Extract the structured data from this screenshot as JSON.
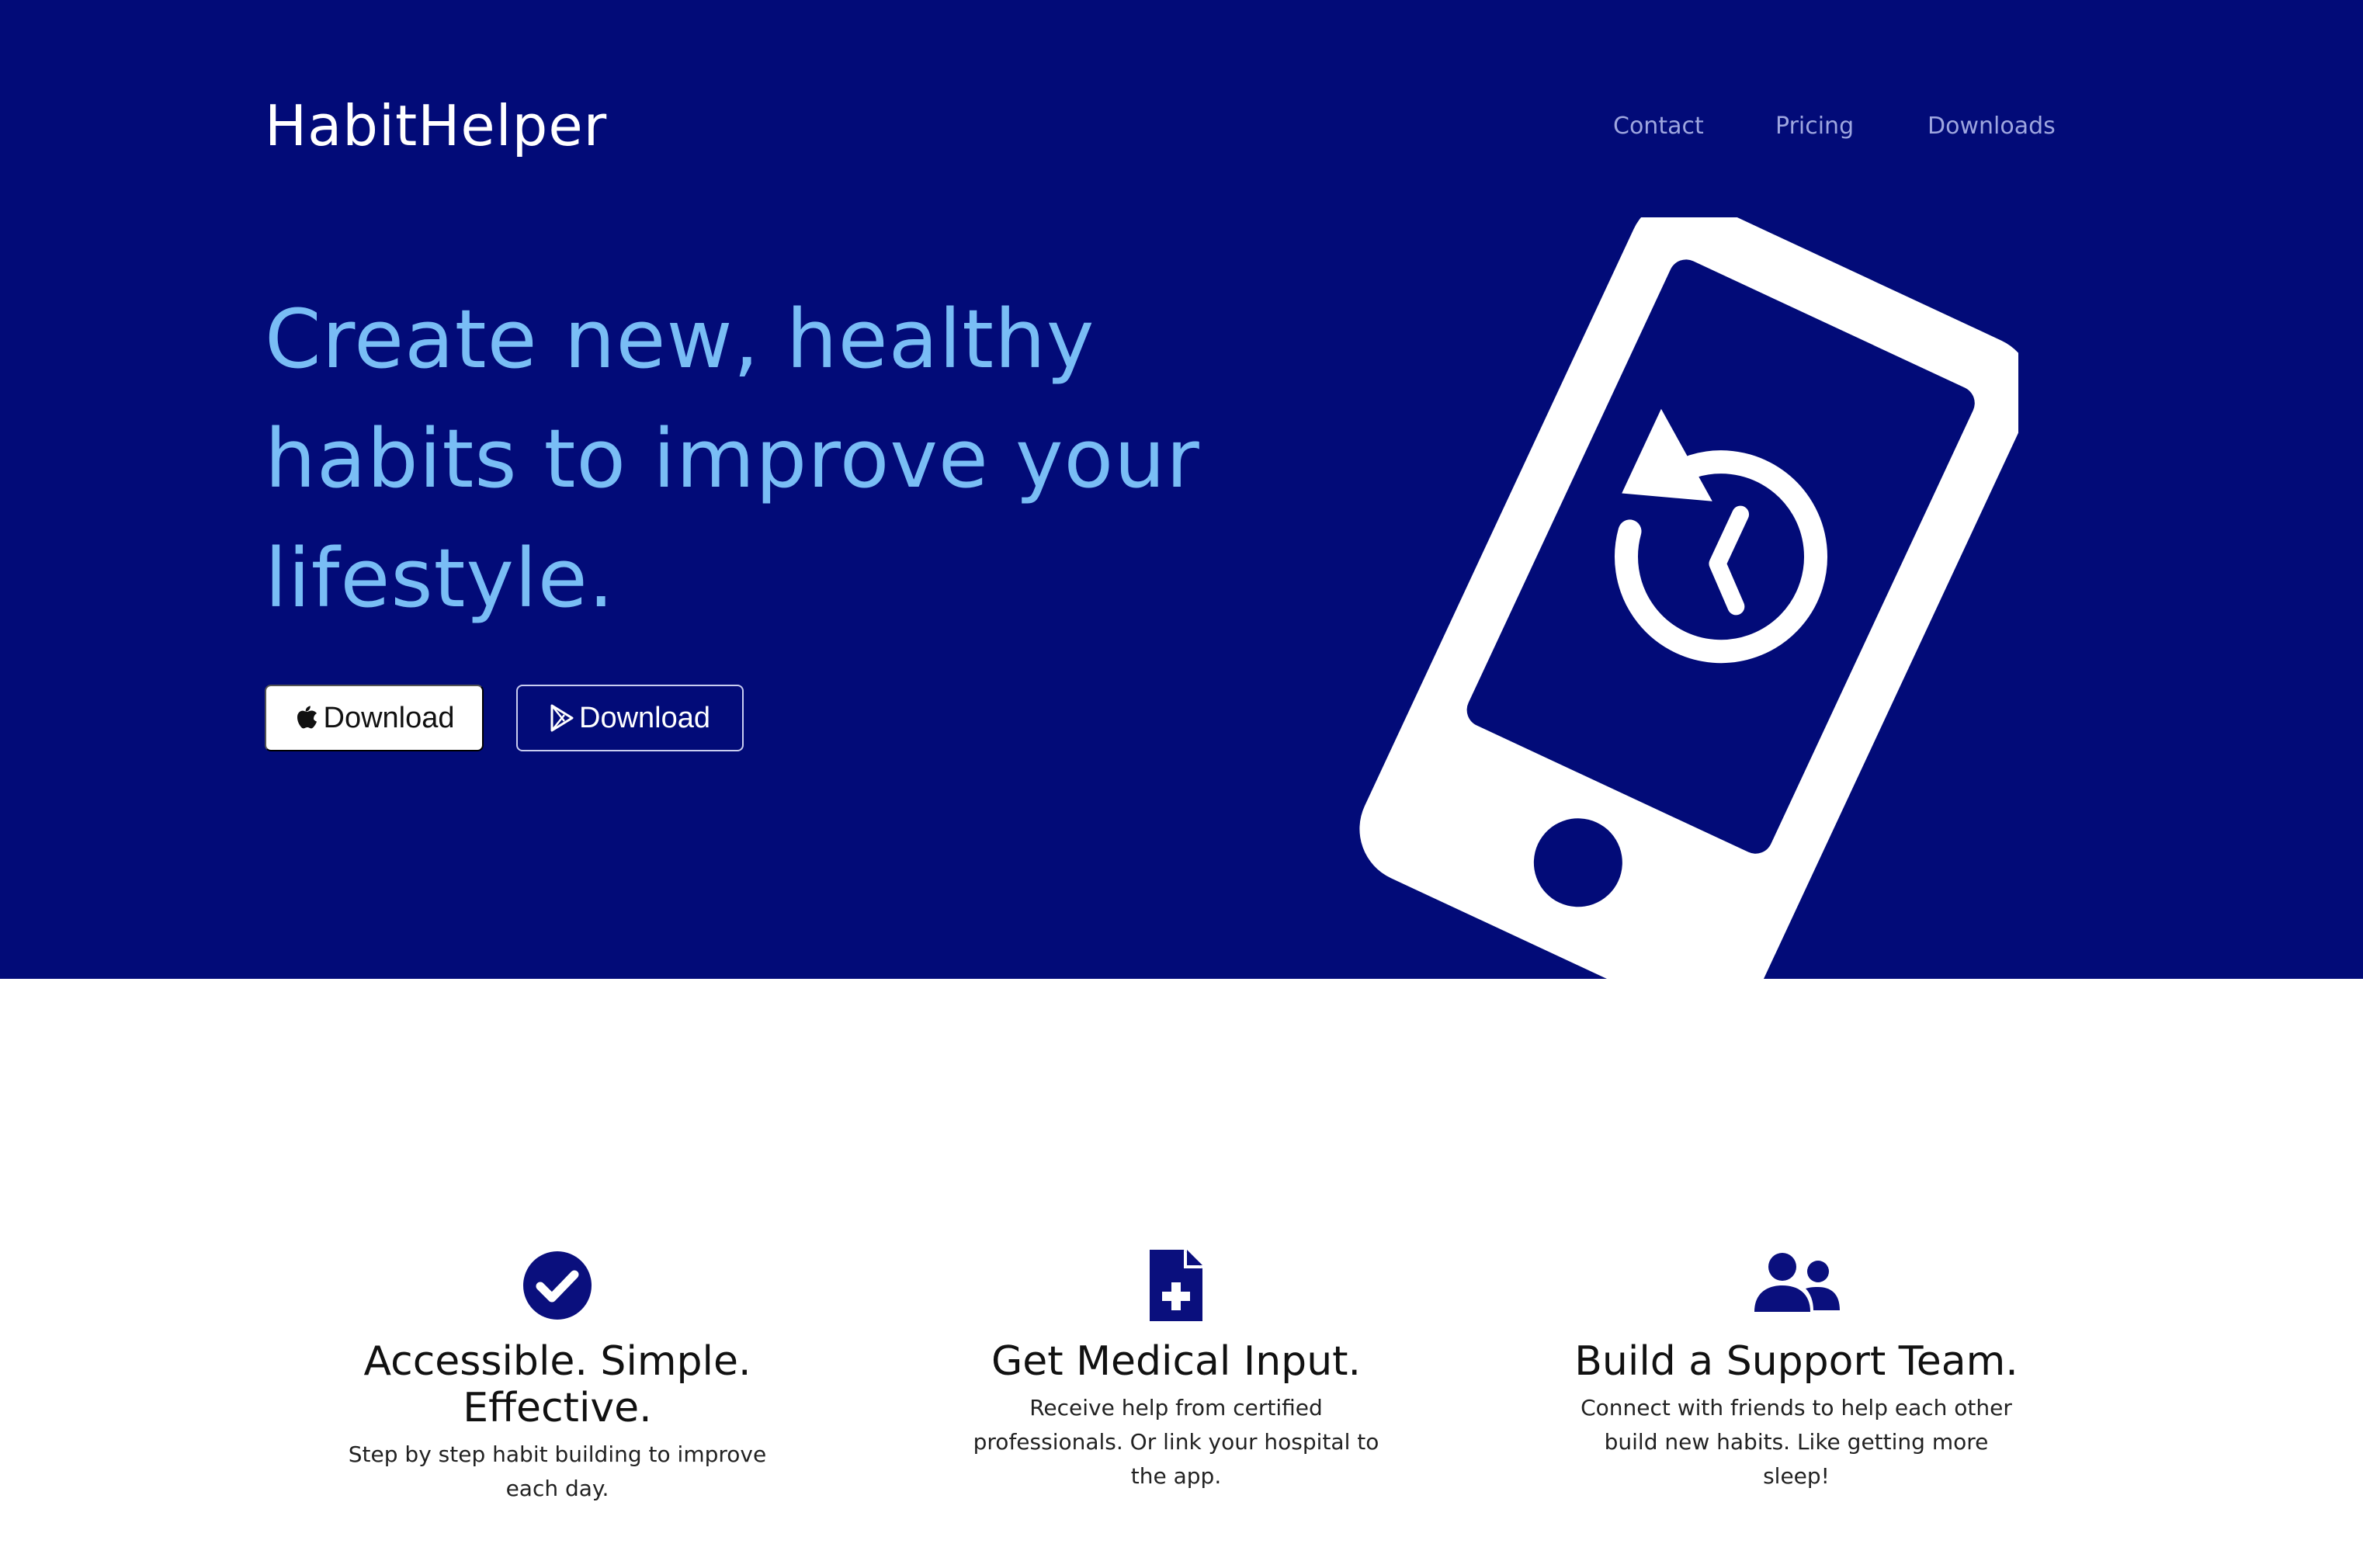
{
  "brand": {
    "name": "HabitHelper"
  },
  "nav": {
    "contact": "Contact",
    "pricing": "Pricing",
    "downloads": "Downloads"
  },
  "hero": {
    "headline": "Create new, healthy habits to improve your lifestyle.",
    "apple_download_label": "Download",
    "play_download_label": "Download",
    "illustration_icon": "mobile-phone-with-history-icon"
  },
  "features": [
    {
      "icon": "check-circle-icon",
      "title": "Accessible. Simple. Effective.",
      "text": "Step by step habit building to improve each day."
    },
    {
      "icon": "medical-file-icon",
      "title": "Get Medical Input.",
      "text": "Receive help from certified professionals. Or link your hospital to the app."
    },
    {
      "icon": "user-group-icon",
      "title": "Build a Support Team.",
      "text": "Connect with friends to help each other build new habits. Like getting more sleep!"
    }
  ],
  "colors": {
    "hero_background": "#020b78",
    "headline": "#79bdf5",
    "nav_link": "#9ea6df",
    "icon": "#0a0f7d"
  }
}
